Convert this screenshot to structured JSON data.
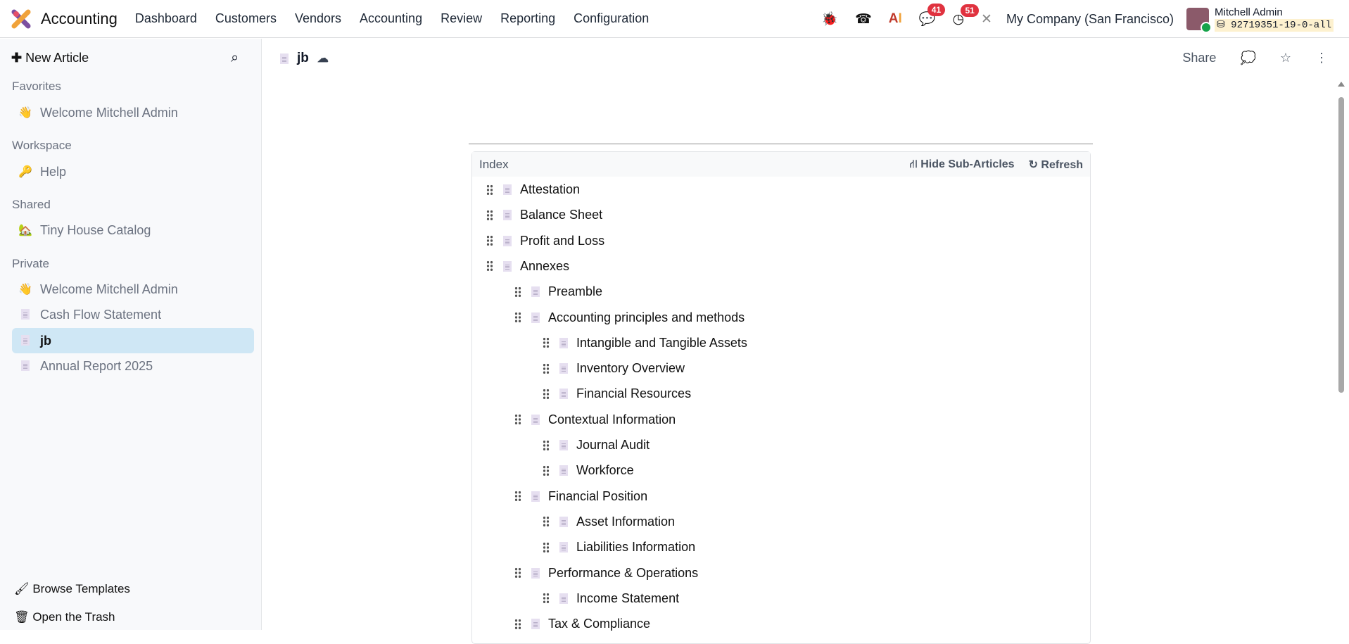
{
  "navbar": {
    "app_name": "Accounting",
    "menu": [
      "Dashboard",
      "Customers",
      "Vendors",
      "Accounting",
      "Review",
      "Reporting",
      "Configuration"
    ],
    "messages_count": "41",
    "activities_count": "51",
    "company": "My Company (San Francisco)",
    "user_name": "Mitchell Admin",
    "database": "92719351-19-0-all"
  },
  "sidebar": {
    "new_article": "New Article",
    "sections": [
      {
        "title": "Favorites",
        "items": [
          {
            "icon": "👋",
            "label": "Welcome Mitchell Admin"
          }
        ]
      },
      {
        "title": "Workspace",
        "items": [
          {
            "icon": "🔑",
            "label": "Help"
          }
        ]
      },
      {
        "title": "Shared",
        "items": [
          {
            "icon": "🏡",
            "label": "Tiny House Catalog"
          }
        ]
      },
      {
        "title": "Private",
        "items": [
          {
            "icon": "👋",
            "label": "Welcome Mitchell Admin"
          },
          {
            "icon": "doc",
            "label": "Cash Flow Statement"
          },
          {
            "icon": "doc",
            "label": "jb",
            "active": true
          },
          {
            "icon": "doc",
            "label": "Annual Report 2025"
          }
        ]
      }
    ],
    "browse_templates": "Browse Templates",
    "open_trash": "Open the Trash"
  },
  "article": {
    "title": "jb",
    "share": "Share"
  },
  "index": {
    "title": "Index",
    "hide_sub_articles": "Hide Sub-Articles",
    "refresh": "Refresh",
    "items": [
      {
        "label": "Attestation",
        "level": 0
      },
      {
        "label": "Balance Sheet",
        "level": 0
      },
      {
        "label": "Profit and Loss",
        "level": 0
      },
      {
        "label": "Annexes",
        "level": 0
      },
      {
        "label": "Preamble",
        "level": 1
      },
      {
        "label": "Accounting principles and methods",
        "level": 1
      },
      {
        "label": "Intangible and Tangible Assets",
        "level": 2
      },
      {
        "label": "Inventory Overview",
        "level": 2
      },
      {
        "label": "Financial Resources",
        "level": 2
      },
      {
        "label": "Contextual Information",
        "level": 1
      },
      {
        "label": "Journal Audit",
        "level": 2
      },
      {
        "label": "Workforce",
        "level": 2
      },
      {
        "label": "Financial Position",
        "level": 1
      },
      {
        "label": "Asset Information",
        "level": 2
      },
      {
        "label": "Liabilities Information",
        "level": 2
      },
      {
        "label": "Performance & Operations",
        "level": 1
      },
      {
        "label": "Income Statement",
        "level": 2
      },
      {
        "label": "Tax & Compliance",
        "level": 1
      }
    ]
  }
}
